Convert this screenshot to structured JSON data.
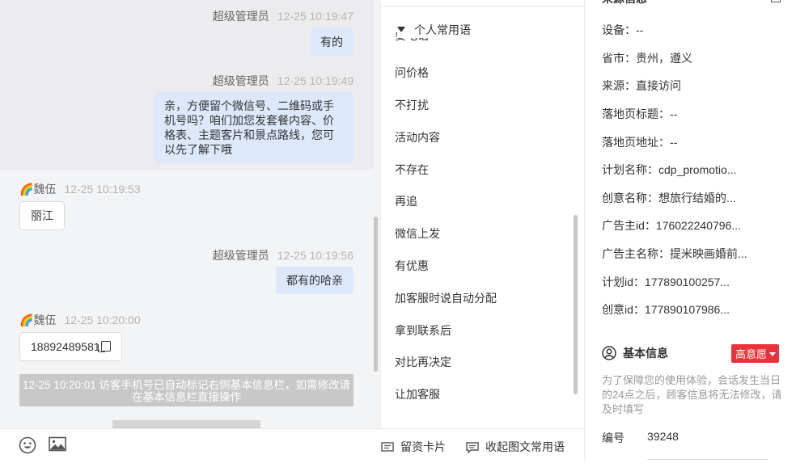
{
  "chat": {
    "messages": [
      {
        "sender": "超级管理员",
        "time": "12-25 10:19:47",
        "text": "有的"
      },
      {
        "sender": "超级管理员",
        "time": "12-25 10:19:49",
        "text": "亲，方便留个微信号、二维码或手机号吗？咱们加您发套餐内容、价格表、主题客片和景点路线，您可以先了解下哦"
      },
      {
        "sender": "🌈魏伍",
        "time": "12-25 10:19:53",
        "text": "丽江"
      },
      {
        "sender": "超级管理员",
        "time": "12-25 10:19:56",
        "text": "都有的哈亲"
      },
      {
        "sender": "🌈魏伍",
        "time": "12-25 10:20:00",
        "text": "18892489581"
      }
    ],
    "system_notice": "12-25 10:20:01 访客手机号已自动标记右侧基本信息栏，如需修改请在基本信息栏直接操作"
  },
  "toolbar": {
    "emoji_icon": "emoji-icon",
    "image_icon": "image-icon",
    "lead_card_label": "留资卡片",
    "collapse_label": "收起图文常用语"
  },
  "phrases": {
    "header": "个人常用语",
    "clipped_item": "要电话",
    "items": [
      "问价格",
      "不打扰",
      "活动内容",
      "不存在",
      "再追",
      "微信上发",
      "有优惠",
      "加客服时说自动分配",
      "拿到联系后",
      "对比再决定",
      "让加客服"
    ]
  },
  "info": {
    "source_title": "来源信息",
    "rows": [
      {
        "label": "设备：",
        "value": "--"
      },
      {
        "label": "省市：",
        "value": "贵州，遵义"
      },
      {
        "label": "来源：",
        "value": "直接访问"
      },
      {
        "label": "落地页标题：",
        "value": "--"
      },
      {
        "label": "落地页地址：",
        "value": "--"
      },
      {
        "label": "计划名称：",
        "value": "cdp_promotio..."
      },
      {
        "label": "创意名称：",
        "value": "想旅行结婚的..."
      },
      {
        "label": "广告主id：",
        "value": "176022240796..."
      },
      {
        "label": "广告主名称：",
        "value": "提米映画婚前..."
      },
      {
        "label": "计划id：",
        "value": "177890100257..."
      },
      {
        "label": "创意id：",
        "value": "177890107986..."
      }
    ],
    "basic_title": "基本信息",
    "intent_badge": "高意愿",
    "notice": "为了保障您的使用体验，会话发生当日的24点之后，顾客信息将无法修改，请及时填写",
    "number_label": "编号",
    "number_value": "39248"
  }
}
